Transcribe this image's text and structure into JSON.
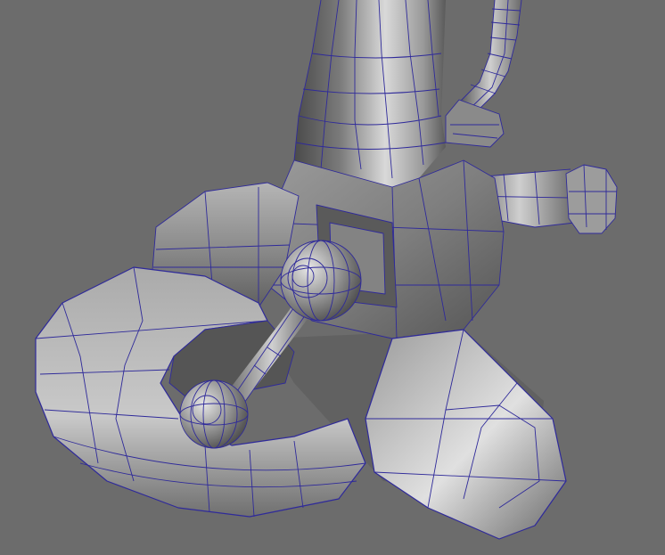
{
  "viewport": {
    "background_color": "#6c6c6c",
    "wireframe_color": "#2f2a9a",
    "shading": "smooth-shaded-with-wireframe"
  },
  "model": {
    "parts": [
      {
        "name": "leg-column"
      },
      {
        "name": "pipe-hose"
      },
      {
        "name": "side-piston"
      },
      {
        "name": "ankle-housing"
      },
      {
        "name": "rear-pad"
      },
      {
        "name": "front-toe"
      },
      {
        "name": "claw-ring"
      },
      {
        "name": "ball-joint-upper"
      },
      {
        "name": "ball-joint-lower"
      },
      {
        "name": "strut-rod"
      }
    ]
  }
}
